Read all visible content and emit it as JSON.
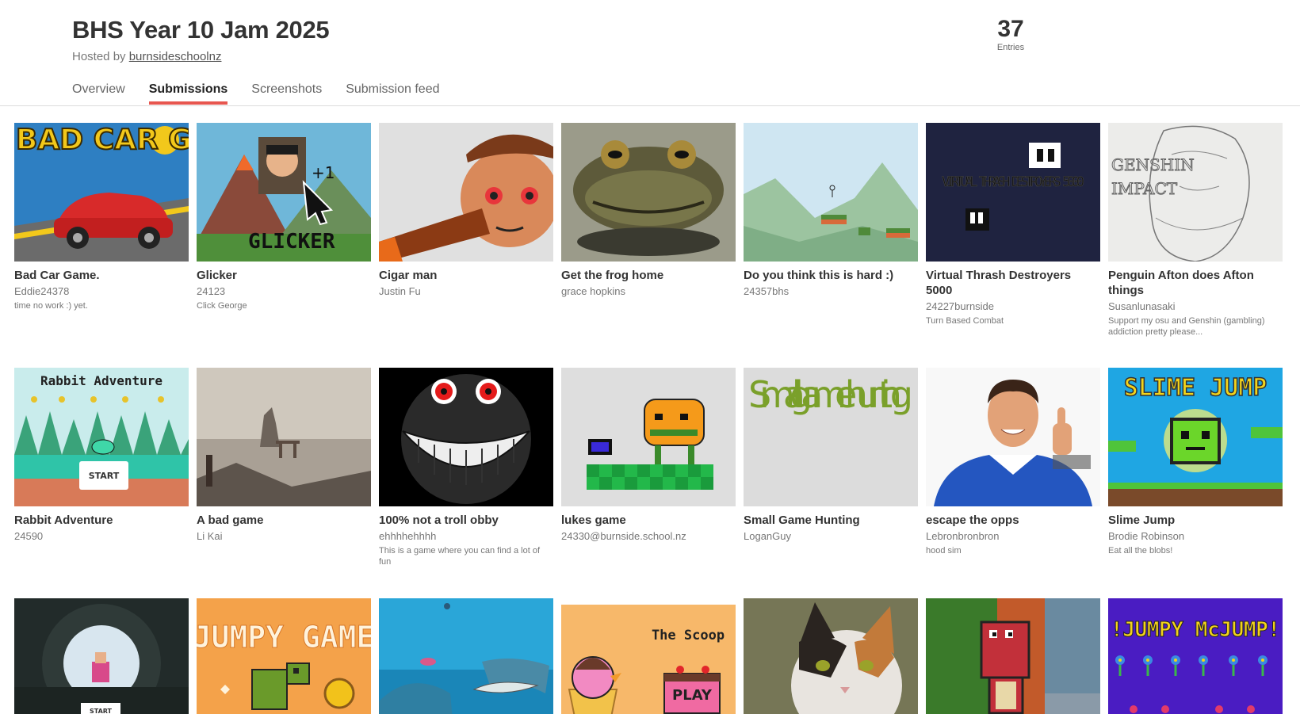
{
  "jam": {
    "title": "BHS Year 10 Jam 2025",
    "hosted_prefix": "Hosted by ",
    "host": "burnsideschoolnz",
    "entries_count": "37",
    "entries_label": "Entries"
  },
  "tabs": [
    "Overview",
    "Submissions",
    "Screenshots",
    "Submission feed"
  ],
  "active_tab": "Submissions",
  "entries": [
    {
      "title": "Bad Car Game.",
      "author": "Eddie24378",
      "desc": "time no work :) yet.",
      "art": "BAD CAR GAME"
    },
    {
      "title": "Glicker",
      "author": "24123",
      "desc": "Click George",
      "art": "GLICKER"
    },
    {
      "title": "Cigar man",
      "author": "Justin Fu",
      "desc": ""
    },
    {
      "title": "Get the frog home",
      "author": "grace hopkins",
      "desc": ""
    },
    {
      "title": "Do you think this is hard :)",
      "author": "24357bhs",
      "desc": ""
    },
    {
      "title": "Virtual Thrash Destroyers 5000",
      "author": "24227burnside",
      "desc": "Turn Based Combat",
      "art": "VIRTUAL THRASH DESTROYERS 5000"
    },
    {
      "title": "Penguin Afton does Afton things",
      "author": "Susanlunasaki",
      "desc": "Support my osu and Genshin (gambling) addiction pretty please..."
    },
    {
      "title": "Rabbit Adventure",
      "author": "24590",
      "desc": "",
      "art": "Rabbit Adventure",
      "art2": "START"
    },
    {
      "title": "A bad game",
      "author": "Li Kai",
      "desc": ""
    },
    {
      "title": "100% not a troll obby",
      "author": "ehhhhehhhh",
      "desc": "This is a game where you can find a lot of fun"
    },
    {
      "title": "lukes game",
      "author": "24330@burnside.school.nz",
      "desc": ""
    },
    {
      "title": "Small Game Hunting",
      "author": "LoganGuy",
      "desc": "",
      "art": "Small game hunting"
    },
    {
      "title": "escape the opps",
      "author": "Lebronbronbron",
      "desc": "hood sim"
    },
    {
      "title": "Slime Jump",
      "author": "Brodie Robinson",
      "desc": "Eat all the blobs!",
      "art": "SLIME JUMP"
    },
    {
      "title": "",
      "author": "",
      "desc": "",
      "art": "START"
    },
    {
      "title": "",
      "author": "",
      "desc": "",
      "art": "JUMPY GAME"
    },
    {
      "title": "",
      "author": "",
      "desc": ""
    },
    {
      "title": "",
      "author": "",
      "desc": "",
      "art": "The Scoop",
      "art2": "PLAY"
    },
    {
      "title": "",
      "author": "",
      "desc": ""
    },
    {
      "title": "",
      "author": "",
      "desc": ""
    },
    {
      "title": "",
      "author": "",
      "desc": "",
      "art": "!JUMPY McJUMP!"
    }
  ]
}
